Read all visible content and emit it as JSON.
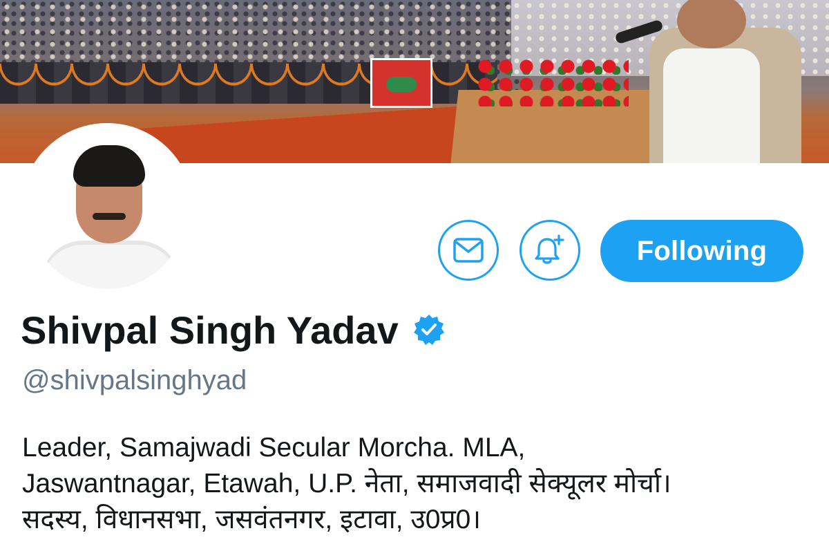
{
  "profile": {
    "display_name": "Shivpal Singh Yadav",
    "handle": "@shivpalsinghyad",
    "bio_lines": [
      "Leader, Samajwadi Secular Morcha. MLA,",
      "Jaswantnagar, Etawah, U.P.  नेता, समाजवादी सेक्यूलर मोर्चा।",
      "सदस्य, विधानसभा, जसवंतनगर, इटावा, उ0प्र0।"
    ],
    "verified": true
  },
  "actions": {
    "follow_label": "Following",
    "message_icon": "envelope-icon",
    "notify_icon": "bell-plus-icon"
  },
  "colors": {
    "accent": "#1da1f2",
    "name_text": "#14171a",
    "handle_text": "#657786"
  }
}
